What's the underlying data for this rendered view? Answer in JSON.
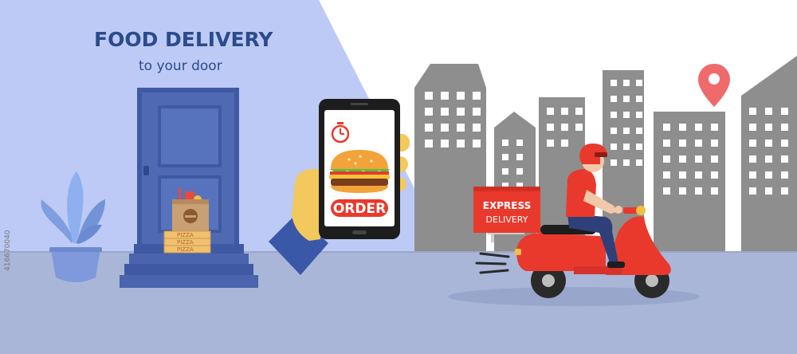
{
  "headline": {
    "title": "FOOD DELIVERY",
    "subtitle": "to your door"
  },
  "phone": {
    "order_button_label": "ORDER"
  },
  "scooter_box": {
    "line1": "EXPRESS",
    "line2": "DELIVERY"
  },
  "pizza_boxes": [
    "PIZZA",
    "PIZZA",
    "PIZZA"
  ],
  "stock_id": "416670040",
  "colors": {
    "sky_left": "#bccaf5",
    "ground": "#a9b6d8",
    "door": "#4f69b2",
    "buildings": "#8e8e8e",
    "accent_red": "#e9392c",
    "title_blue": "#2c4b8c",
    "hand_yellow": "#f3c85c"
  },
  "icons": [
    "stopwatch-icon",
    "burger-icon",
    "location-pin-icon",
    "plant-icon",
    "door-knob-icon",
    "speed-lines-icon"
  ]
}
